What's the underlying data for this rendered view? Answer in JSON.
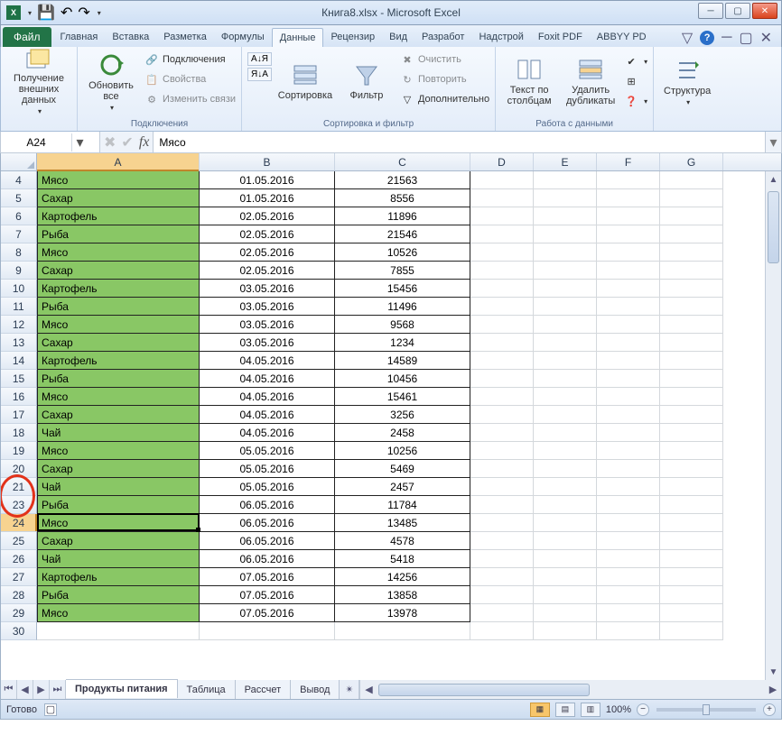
{
  "window": {
    "title": "Книга8.xlsx - Microsoft Excel"
  },
  "qat": {
    "save_tip": "Сохранить",
    "undo_tip": "Отменить",
    "redo_tip": "Вернуть"
  },
  "tabs": {
    "file": "Файл",
    "items": [
      "Главная",
      "Вставка",
      "Разметка",
      "Формулы",
      "Данные",
      "Рецензир",
      "Вид",
      "Разработ",
      "Надстрой",
      "Foxit PDF",
      "ABBYY PD"
    ],
    "active_index": 4
  },
  "ribbon": {
    "group_ext": {
      "label": "",
      "btn": "Получение\nвнешних данных"
    },
    "group_conn": {
      "label": "Подключения",
      "refresh": "Обновить\nвсе",
      "connections": "Подключения",
      "properties": "Свойства",
      "editlinks": "Изменить связи"
    },
    "group_sort": {
      "label": "Сортировка и фильтр",
      "az": "А↓Я",
      "za": "Я↓А",
      "sort": "Сортировка",
      "filter": "Фильтр",
      "clear": "Очистить",
      "reapply": "Повторить",
      "advanced": "Дополнительно"
    },
    "group_tools": {
      "label": "Работа с данными",
      "t2c": "Текст по\nстолбцам",
      "dedup": "Удалить\nдубликаты"
    },
    "group_outline": {
      "label": "",
      "btn": "Структура"
    }
  },
  "namebox": {
    "value": "A24"
  },
  "formulabar": {
    "value": "Мясо"
  },
  "columns": [
    "A",
    "B",
    "C",
    "D",
    "E",
    "F",
    "G"
  ],
  "rows": [
    {
      "r": 4,
      "a": "Мясо",
      "b": "01.05.2016",
      "c": "21563"
    },
    {
      "r": 5,
      "a": "Сахар",
      "b": "01.05.2016",
      "c": "8556"
    },
    {
      "r": 6,
      "a": "Картофель",
      "b": "02.05.2016",
      "c": "11896"
    },
    {
      "r": 7,
      "a": "Рыба",
      "b": "02.05.2016",
      "c": "21546"
    },
    {
      "r": 8,
      "a": "Мясо",
      "b": "02.05.2016",
      "c": "10526"
    },
    {
      "r": 9,
      "a": "Сахар",
      "b": "02.05.2016",
      "c": "7855"
    },
    {
      "r": 10,
      "a": "Картофель",
      "b": "03.05.2016",
      "c": "15456"
    },
    {
      "r": 11,
      "a": "Рыба",
      "b": "03.05.2016",
      "c": "11496"
    },
    {
      "r": 12,
      "a": "Мясо",
      "b": "03.05.2016",
      "c": "9568"
    },
    {
      "r": 13,
      "a": "Сахар",
      "b": "03.05.2016",
      "c": "1234"
    },
    {
      "r": 14,
      "a": "Картофель",
      "b": "04.05.2016",
      "c": "14589"
    },
    {
      "r": 15,
      "a": "Рыба",
      "b": "04.05.2016",
      "c": "10456"
    },
    {
      "r": 16,
      "a": "Мясо",
      "b": "04.05.2016",
      "c": "15461"
    },
    {
      "r": 17,
      "a": "Сахар",
      "b": "04.05.2016",
      "c": "3256"
    },
    {
      "r": 18,
      "a": "Чай",
      "b": "04.05.2016",
      "c": "2458"
    },
    {
      "r": 19,
      "a": "Мясо",
      "b": "05.05.2016",
      "c": "10256"
    },
    {
      "r": 20,
      "a": "Сахар",
      "b": "05.05.2016",
      "c": "5469"
    },
    {
      "r": 21,
      "a": "Чай",
      "b": "05.05.2016",
      "c": "2457"
    },
    {
      "r": 23,
      "a": "Рыба",
      "b": "06.05.2016",
      "c": "11784"
    },
    {
      "r": 24,
      "a": "Мясо",
      "b": "06.05.2016",
      "c": "13485"
    },
    {
      "r": 25,
      "a": "Сахар",
      "b": "06.05.2016",
      "c": "4578"
    },
    {
      "r": 26,
      "a": "Чай",
      "b": "06.05.2016",
      "c": "5418"
    },
    {
      "r": 27,
      "a": "Картофель",
      "b": "07.05.2016",
      "c": "14256"
    },
    {
      "r": 28,
      "a": "Рыба",
      "b": "07.05.2016",
      "c": "13858"
    },
    {
      "r": 29,
      "a": "Мясо",
      "b": "07.05.2016",
      "c": "13978"
    },
    {
      "r": 30,
      "a": "",
      "b": "",
      "c": ""
    }
  ],
  "active_cell_row_num": 24,
  "sheets": {
    "items": [
      "Продукты питания",
      "Таблица",
      "Рассчет",
      "Вывод"
    ],
    "active_index": 0
  },
  "status": {
    "ready": "Готово",
    "zoom": "100%"
  }
}
